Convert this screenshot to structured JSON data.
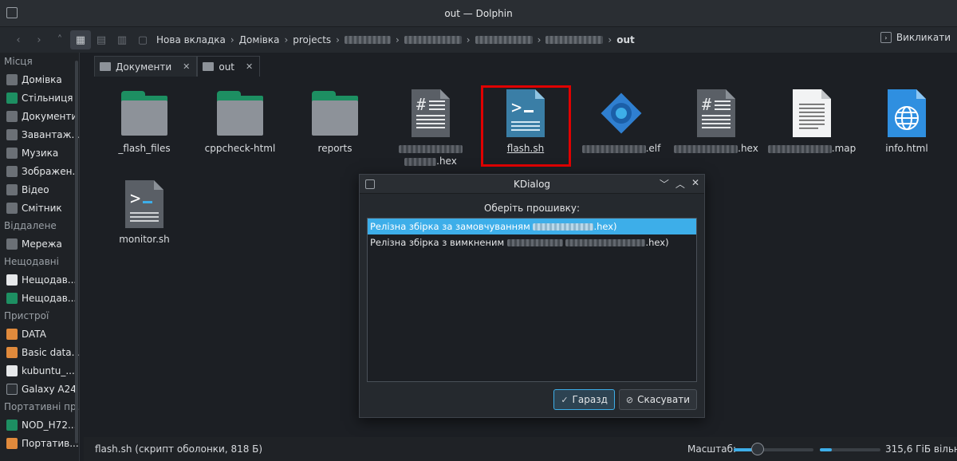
{
  "window": {
    "title": "out — Dolphin"
  },
  "toolbar": {
    "breadcrumbs": [
      "Нова вкладка",
      "Домівка",
      "projects",
      "out"
    ],
    "call_label": "Викликати"
  },
  "sidebar": {
    "sections": [
      {
        "title": "Місця",
        "items": [
          {
            "label": "Домівка",
            "color": "#6b7076"
          },
          {
            "label": "Стільниця",
            "color": "#1d8f62"
          },
          {
            "label": "Документи",
            "color": "#6b7076"
          },
          {
            "label": "Завантаж...",
            "color": "#6b7076"
          },
          {
            "label": "Музика",
            "color": "#6b7076"
          },
          {
            "label": "Зображен...",
            "color": "#6b7076"
          },
          {
            "label": "Відео",
            "color": "#6b7076"
          },
          {
            "label": "Смітник",
            "color": "#6b7076"
          }
        ]
      },
      {
        "title": "Віддалене",
        "items": [
          {
            "label": "Мережа",
            "color": "#6b7076"
          }
        ]
      },
      {
        "title": "Нещодавні",
        "items": [
          {
            "label": "Нещодав...",
            "color": "#e6e8ea"
          },
          {
            "label": "Нещодав...",
            "color": "#1d8f62"
          }
        ]
      },
      {
        "title": "Пристрої",
        "items": [
          {
            "label": "DATA",
            "color": "#e08a3c"
          },
          {
            "label": "Basic data...",
            "color": "#e08a3c"
          },
          {
            "label": "kubuntu_...",
            "color": "#e6e8ea"
          },
          {
            "label": "Galaxy A24",
            "color": "#2b2f34"
          }
        ]
      },
      {
        "title": "Портативні пр...",
        "items": [
          {
            "label": "NOD_H72...",
            "color": "#1d8f62"
          },
          {
            "label": "Портатив...",
            "color": "#e08a3c"
          }
        ]
      }
    ]
  },
  "tabs": [
    {
      "label": "Документи",
      "active": false
    },
    {
      "label": "out",
      "active": true
    }
  ],
  "files": [
    {
      "name": "_flash_files",
      "kind": "folder"
    },
    {
      "name": "cppcheck-html",
      "kind": "folder"
    },
    {
      "name": "reports",
      "kind": "folder"
    },
    {
      "name": ".hex",
      "kind": "hex"
    },
    {
      "name": "flash.sh",
      "kind": "script"
    },
    {
      "name": ".elf",
      "kind": "elf"
    },
    {
      "name": ".hex",
      "kind": "hex"
    },
    {
      "name": ".map",
      "kind": "text"
    },
    {
      "name": "info.html",
      "kind": "html"
    },
    {
      "name": "monitor.sh",
      "kind": "script-dark"
    }
  ],
  "dialog": {
    "title": "KDialog",
    "prompt": "Оберіть прошивку:",
    "options": [
      {
        "text_before": "Релізна збірка за замовчуванням ",
        "text_after": ".hex)",
        "selected": true
      },
      {
        "text_before": "Релізна збірка з вимкненим ",
        "text_after": ".hex)",
        "selected": false
      }
    ],
    "ok_label": "Гаразд",
    "cancel_label": "Скасувати"
  },
  "status": {
    "selection_text": "flash.sh (скрипт оболонки, 818 Б)",
    "zoom_label": "Масштаб:",
    "zoom_fraction": 0.3,
    "free_space": "315,6 ГіБ вільно"
  },
  "colors": {
    "accent": "#3daee9",
    "folder_tab": "#1d8f62",
    "highlight_box": "#e00000"
  }
}
